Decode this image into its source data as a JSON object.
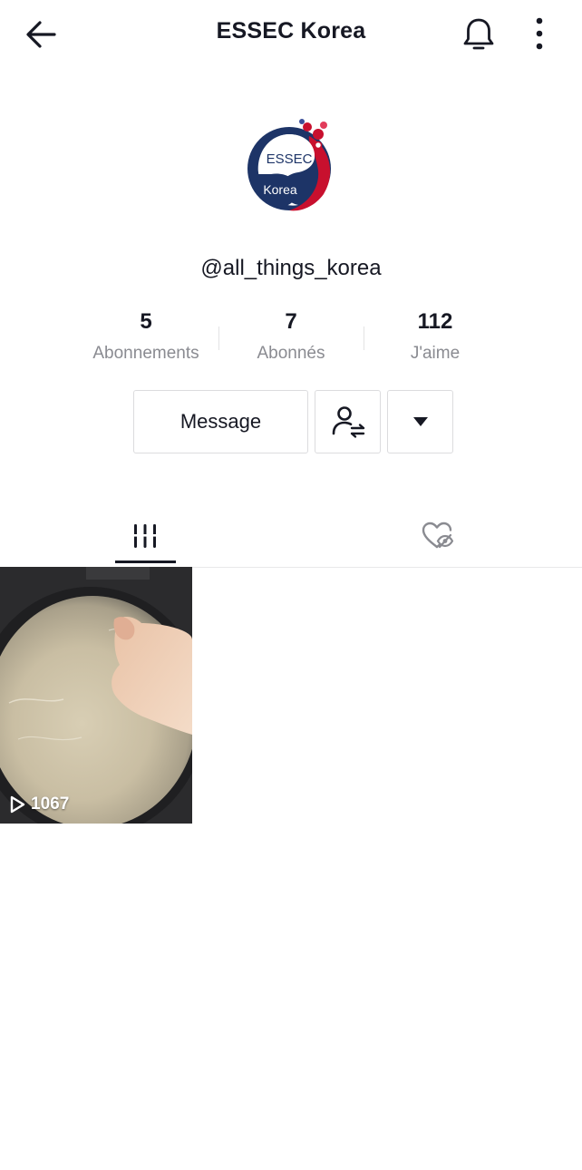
{
  "header": {
    "title": "ESSEC Korea",
    "icons": {
      "back": "arrow-left-icon",
      "bell": "bell-icon",
      "more": "more-vertical-icon"
    }
  },
  "profile": {
    "avatar_text_top": "ESSEC",
    "avatar_text_bottom": "Korea",
    "username": "@all_things_korea"
  },
  "stats": [
    {
      "value": "5",
      "label": "Abonnements"
    },
    {
      "value": "7",
      "label": "Abonnés"
    },
    {
      "value": "112",
      "label": "J'aime"
    }
  ],
  "actions": {
    "message_label": "Message",
    "icons": {
      "follow": "user-swap-icon",
      "more": "caret-down-icon"
    }
  },
  "tabs": [
    {
      "id": "videos",
      "icon": "grid-icon",
      "active": true
    },
    {
      "id": "liked",
      "icon": "heart-hidden-icon",
      "active": false
    }
  ],
  "videos": [
    {
      "views": "1067",
      "icon": "play-icon"
    }
  ],
  "colors": {
    "text": "#161823",
    "muted": "#8a8b91",
    "border": "#dcdcde",
    "avatar_blue": "#1d3467",
    "avatar_red": "#c8102e"
  }
}
